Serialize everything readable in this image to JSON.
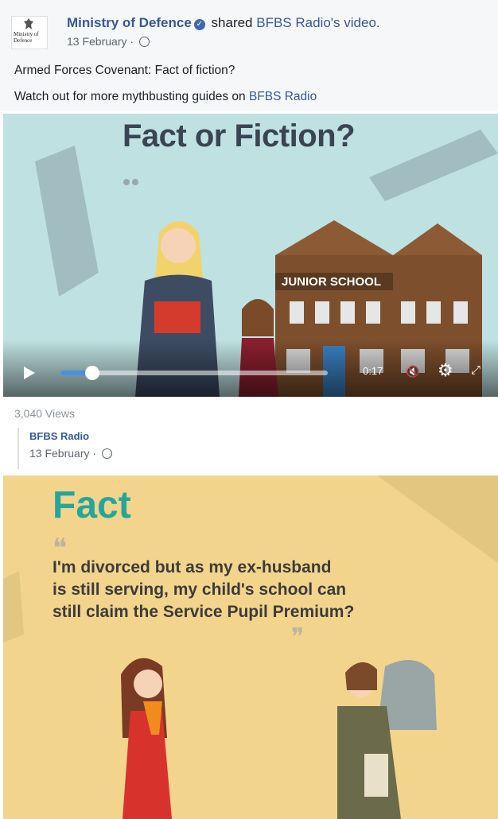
{
  "post": {
    "author": "Ministry of Defence",
    "action": " shared ",
    "shared_source": "BFBS Radio's video.",
    "date": "13 February · ",
    "avatar_text": "Ministry of Defence",
    "text_line1": "Armed Forces Covenant: Fact of fiction?",
    "text_line2_prefix": "Watch out for more mythbusting guides on ",
    "text_line2_link": "BFBS Radio"
  },
  "video": {
    "title": "Fact or Fiction?",
    "school_sign": "JUNIOR SCHOOL",
    "progress_fraction": 0.12,
    "time": "0:17",
    "views": "3,040 Views"
  },
  "shared": {
    "name": "BFBS Radio",
    "date": "13 February · "
  },
  "panel": {
    "heading": "Fact",
    "question_lines": [
      "I'm divorced but as my ex-husband",
      "is still serving, my child's school can",
      "still claim the Service Pupil Premium?"
    ]
  },
  "colors": {
    "link": "#385898",
    "video_bg": "#bfe1e2",
    "panel_bg": "#f2d48d",
    "fact_teal": "#26a69a",
    "progress": "#4a90e2"
  }
}
